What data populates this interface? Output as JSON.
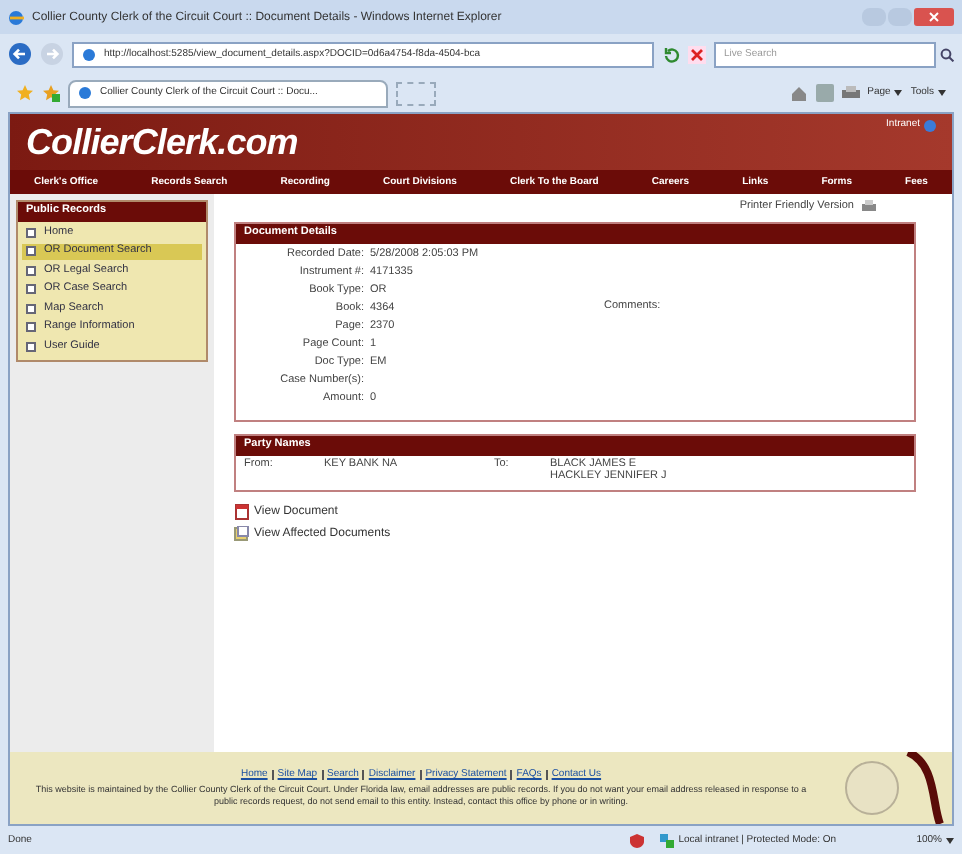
{
  "window": {
    "title": "Collier County Clerk of the Circuit Court :: Document Details - Windows Internet Explorer"
  },
  "address_bar": {
    "url": "http://localhost:5285/view_document_details.aspx?DOCID=0d6a4754-f8da-4504-bca",
    "search_placeholder": "Live Search"
  },
  "tab": {
    "title": "Collier County Clerk of the Circuit Court :: Docu..."
  },
  "toolbar": [
    "Page",
    "Tools"
  ],
  "site": {
    "logo": "CollierClerk.com",
    "badge": "Intranet",
    "nav": [
      "Clerk's Office",
      "Records Search",
      "Recording",
      "Court Divisions",
      "Clerk To the Board",
      "Careers",
      "Links",
      "Forms",
      "Fees"
    ]
  },
  "sidebar": {
    "title": "Public Records",
    "items": [
      {
        "label": "Home",
        "selected": false
      },
      {
        "label": "OR Document Search",
        "selected": true
      },
      {
        "label": "OR Legal Search",
        "selected": false
      },
      {
        "label": "OR Case Search",
        "selected": false
      },
      {
        "label": "Map Search",
        "selected": false
      },
      {
        "label": "Range Information",
        "selected": false
      },
      {
        "label": "User Guide",
        "selected": false
      }
    ]
  },
  "printer_link": "Printer Friendly Version",
  "document_details": {
    "title": "Document Details",
    "fields": [
      {
        "label": "Recorded Date:",
        "value": "5/28/2008 2:05:03 PM"
      },
      {
        "label": "Instrument #:",
        "value": "4171335"
      },
      {
        "label": "Book Type:",
        "value": "OR"
      },
      {
        "label": "Book:",
        "value": "4364"
      },
      {
        "label": "Page:",
        "value": "2370"
      },
      {
        "label": "Page Count:",
        "value": "1"
      },
      {
        "label": "Doc Type:",
        "value": "EM"
      },
      {
        "label": "Case Number(s):"
      },
      {
        "label": "Amount:",
        "value": "0"
      }
    ],
    "comments_label": "Comments:"
  },
  "party_names": {
    "title": "Party Names",
    "from_label": "From:",
    "from": [
      "KEY BANK NA"
    ],
    "to_label": "To:",
    "to": [
      "BLACK JAMES E",
      "HACKLEY JENNIFER J"
    ]
  },
  "links": [
    {
      "kind": "document",
      "label": "View Document"
    },
    {
      "kind": "affected",
      "label": "View Affected Documents"
    }
  ],
  "footer": {
    "links": [
      "Home",
      "Site Map",
      "Search",
      "Disclaimer",
      "Privacy Statement",
      "FAQs",
      "Contact Us"
    ],
    "notice": "This website is maintained by the Collier County Clerk of the Circuit Court. Under Florida law, email addresses are public records. If you do not want your email address released in response to a public records request, do not send email to this entity. Instead, contact this office by phone or in writing."
  },
  "status_bar": {
    "status": "Done",
    "zone": "Local intranet | Protected Mode: On",
    "zoom": "100%"
  }
}
